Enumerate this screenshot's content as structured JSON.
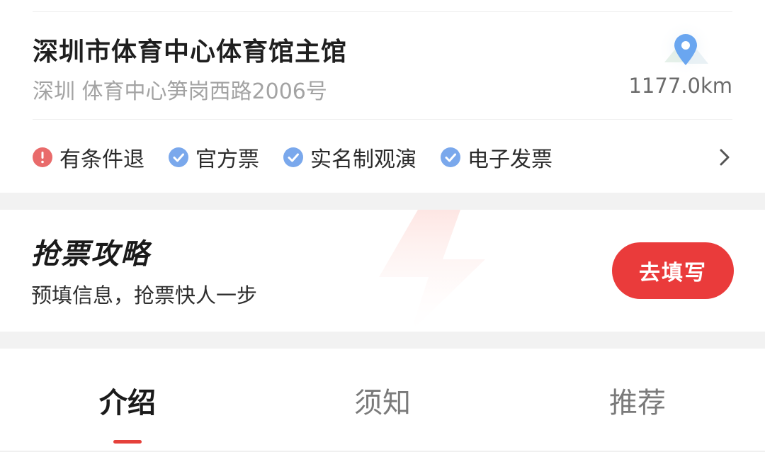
{
  "venue": {
    "name": "深圳市体育中心体育馆主馆",
    "address": "深圳 体育中心笋岗西路2006号",
    "distance": "1177.0km",
    "map_icon": "map-pin-icon"
  },
  "tags": [
    {
      "label": "有条件退",
      "icon": "exclamation-icon",
      "color": "#e96b6b"
    },
    {
      "label": "官方票",
      "icon": "check-icon",
      "color": "#7aa8ec"
    },
    {
      "label": "实名制观演",
      "icon": "check-icon",
      "color": "#7aa8ec"
    },
    {
      "label": "电子发票",
      "icon": "check-icon",
      "color": "#7aa8ec"
    }
  ],
  "banner": {
    "title": "抢票攻略",
    "subtitle": "预填信息，抢票快人一步",
    "button_label": "去填写",
    "accent": "#ea3b3b"
  },
  "tabs": [
    {
      "label": "介绍",
      "active": true
    },
    {
      "label": "须知",
      "active": false
    },
    {
      "label": "推荐",
      "active": false
    }
  ]
}
